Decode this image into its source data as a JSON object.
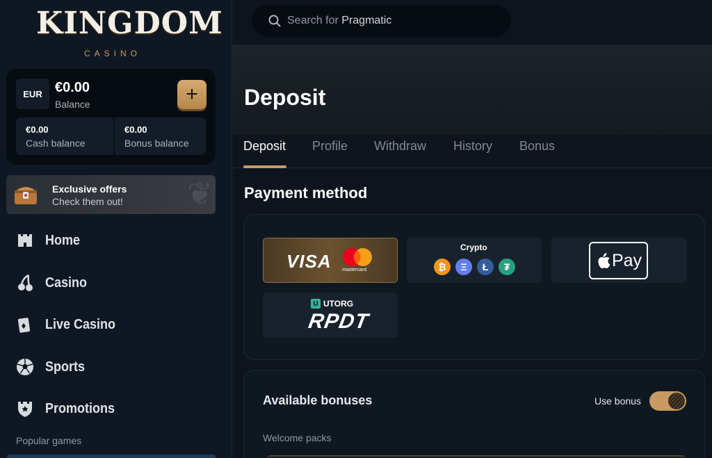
{
  "brand": {
    "name": "KINGDOM",
    "sub": "CASINO"
  },
  "wallet": {
    "currency": "EUR",
    "balance": "€0.00",
    "balance_label": "Balance",
    "cash_value": "€0.00",
    "cash_label": "Cash balance",
    "bonus_value": "€0.00",
    "bonus_label": "Bonus balance",
    "add_label": "+"
  },
  "offers": {
    "title": "Exclusive offers",
    "subtitle": "Check them out!"
  },
  "nav": [
    {
      "label": "Home",
      "icon": "castle-icon"
    },
    {
      "label": "Casino",
      "icon": "cherries-icon"
    },
    {
      "label": "Live Casino",
      "icon": "cards-icon"
    },
    {
      "label": "Sports",
      "icon": "soccer-ball-icon"
    },
    {
      "label": "Promotions",
      "icon": "shield-star-icon"
    }
  ],
  "popular_label": "Popular games",
  "search": {
    "prefix": "Search for ",
    "term": "Pragmatic"
  },
  "page": {
    "title": "Deposit"
  },
  "tabs": [
    "Deposit",
    "Profile",
    "Withdraw",
    "History",
    "Bonus"
  ],
  "active_tab": "Deposit",
  "payment": {
    "title": "Payment method",
    "methods": {
      "visa": "VISA",
      "mastercard": "mastercard",
      "crypto": "Crypto",
      "applepay": "Pay",
      "utorg": "UTORG",
      "rpdt": "RPDT"
    },
    "coins": [
      "₿",
      "Ξ",
      "Ł",
      "₮"
    ],
    "coin_colors": [
      "#f7931a",
      "#627eea",
      "#345d9d",
      "#26a17b"
    ]
  },
  "bonuses": {
    "title": "Available bonuses",
    "use_label": "Use bonus",
    "use_enabled": true,
    "welcome_label": "Welcome packs"
  },
  "colors": {
    "accent": "#c89a62",
    "background": "#0d141d",
    "panel": "#0f1820"
  }
}
